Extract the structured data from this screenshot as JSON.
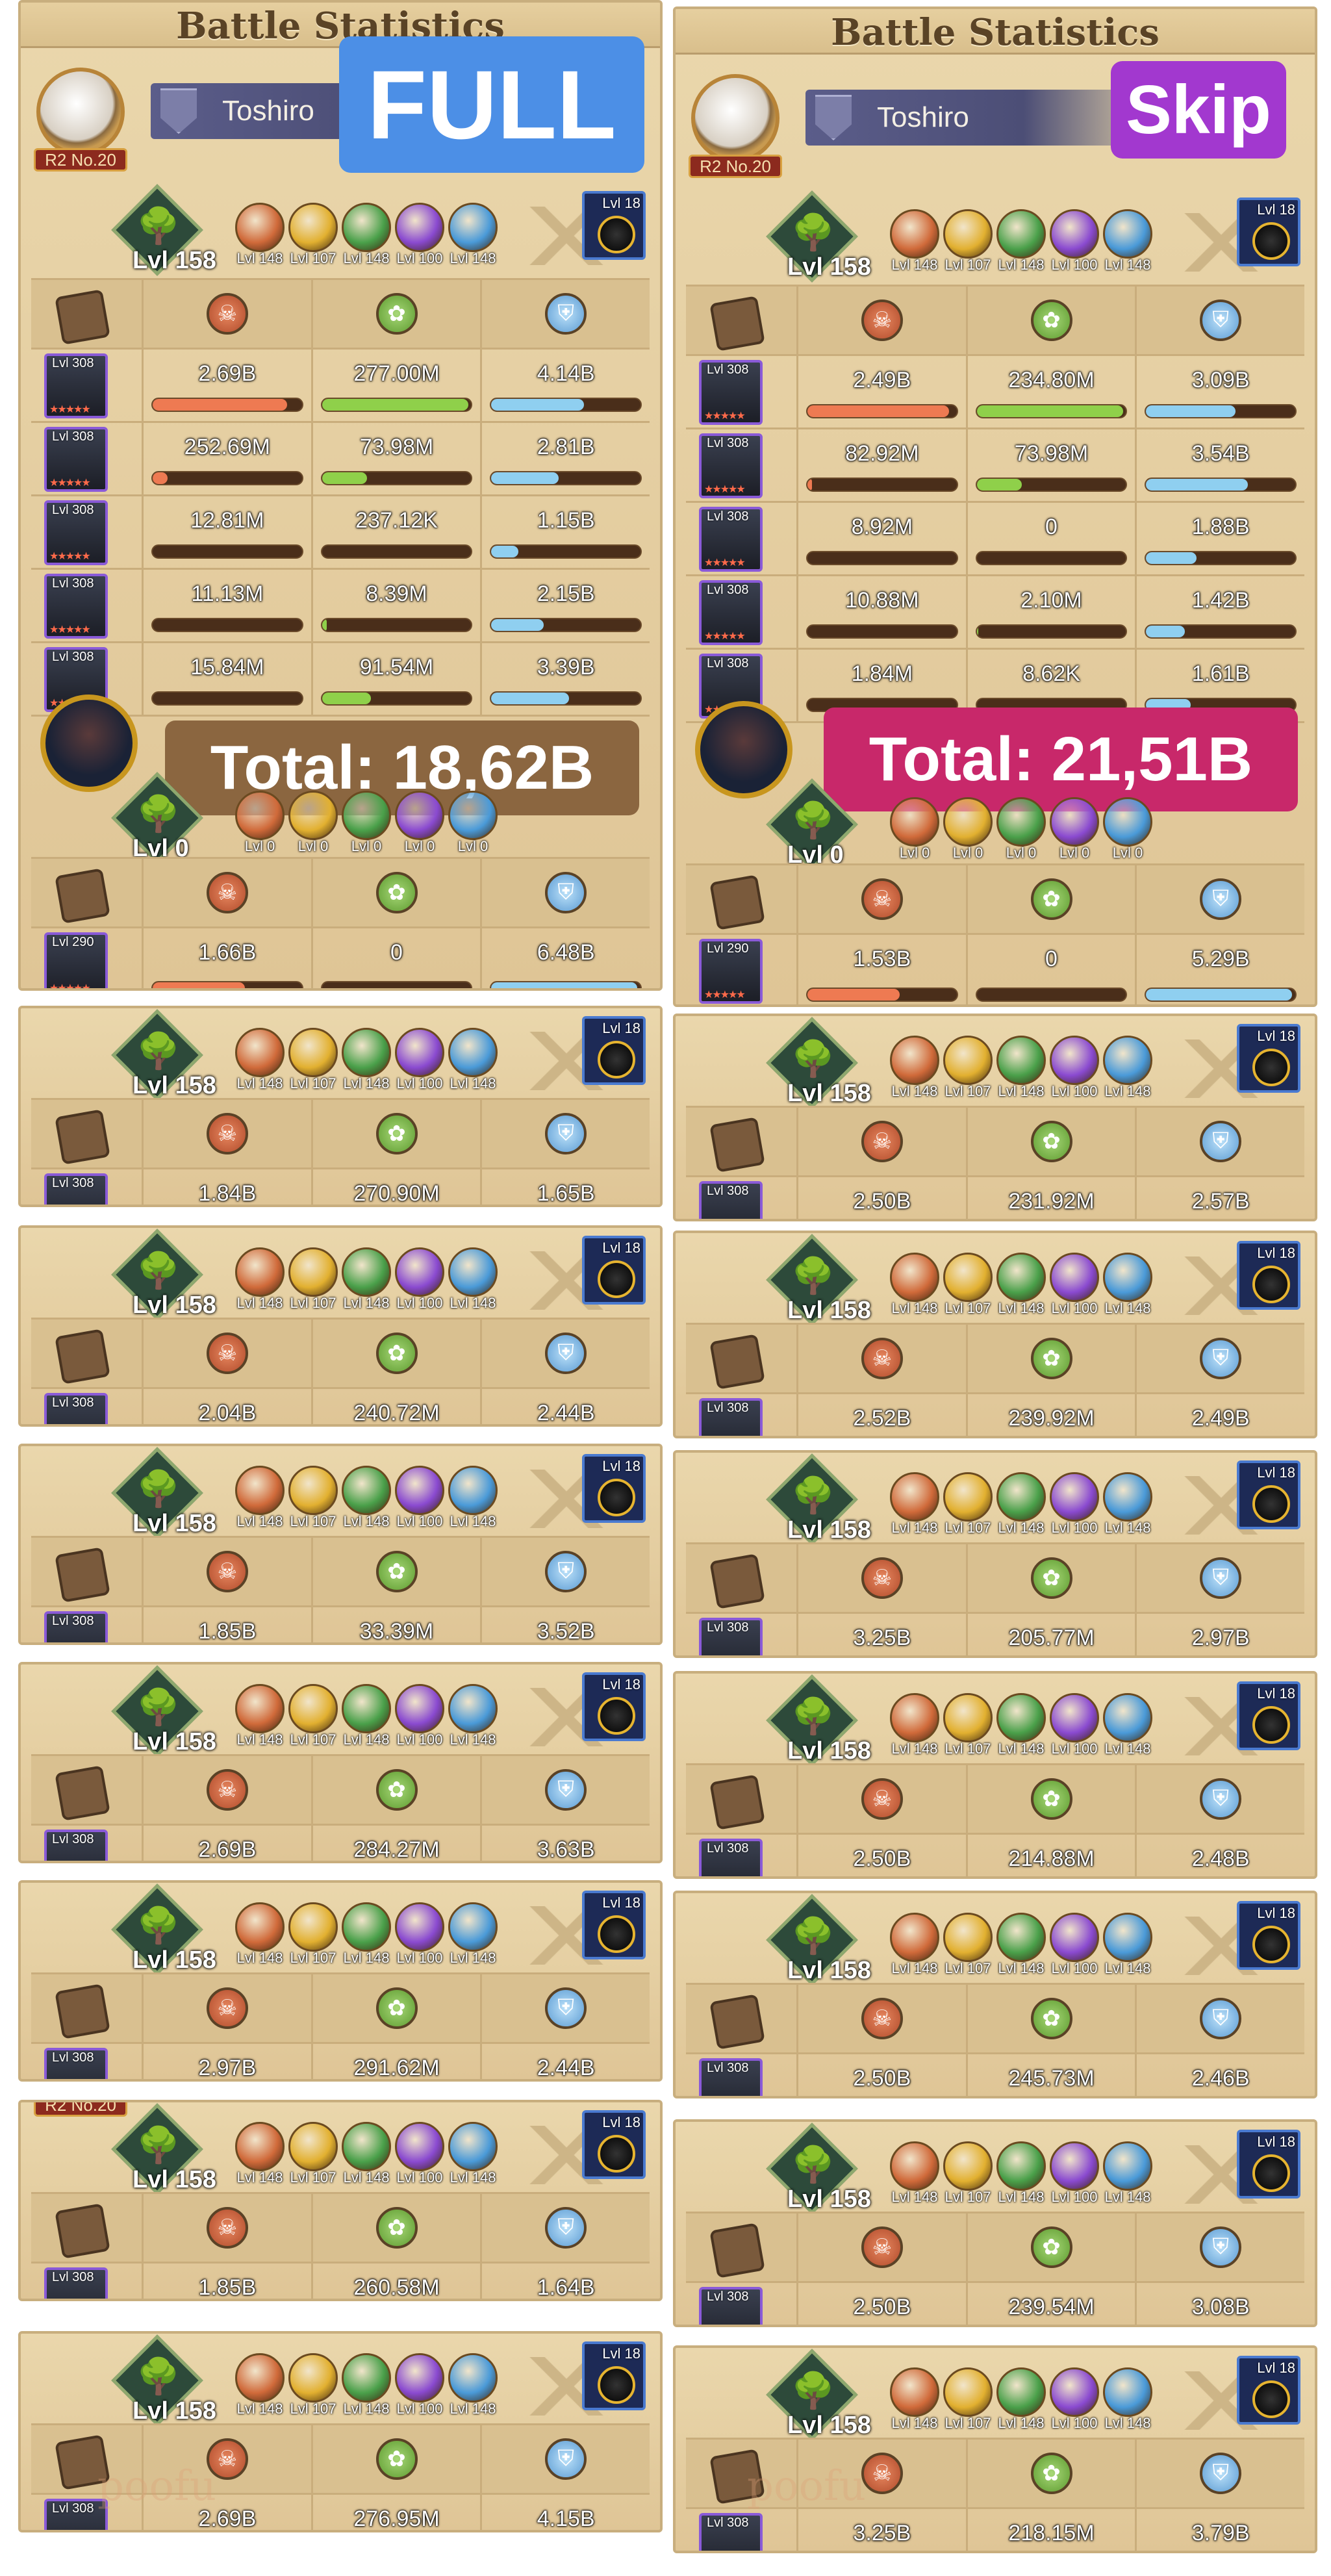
{
  "header_title": "Battle Statistics",
  "columns": [
    {
      "id": "left",
      "tag": {
        "text": "FULL",
        "color": "#4c8fe6"
      },
      "player": {
        "name": "Toshiro",
        "rank": "R2 No.20"
      },
      "team": {
        "level": "Lvl 158",
        "orb_levels": [
          "Lvl 148",
          "Lvl 107",
          "Lvl 148",
          "Lvl 100",
          "Lvl 148"
        ],
        "beast_level": "Lvl 18"
      },
      "heroes": [
        {
          "level": "Lvl 308",
          "stars": "★★★★★",
          "dmg": "2.69B",
          "heal": "277.00M",
          "def": "4.14B",
          "dmg_f": 0.9,
          "heal_f": 0.98,
          "def_f": 0.62
        },
        {
          "level": "Lvl 308",
          "stars": "★★★★★",
          "dmg": "252.69M",
          "heal": "73.98M",
          "def": "2.81B",
          "dmg_f": 0.1,
          "heal_f": 0.3,
          "def_f": 0.45
        },
        {
          "level": "Lvl 308",
          "stars": "★★★★★",
          "dmg": "12.81M",
          "heal": "237.12K",
          "def": "1.15B",
          "dmg_f": 0.0,
          "heal_f": 0.0,
          "def_f": 0.18
        },
        {
          "level": "Lvl 308",
          "stars": "★★★★★",
          "dmg": "11.13M",
          "heal": "8.39M",
          "def": "2.15B",
          "dmg_f": 0.0,
          "heal_f": 0.03,
          "def_f": 0.35
        },
        {
          "level": "Lvl 308",
          "stars": "★★",
          "dmg": "15.84M",
          "heal": "91.54M",
          "def": "3.39B",
          "dmg_f": 0.0,
          "heal_f": 0.33,
          "def_f": 0.52
        }
      ],
      "total": {
        "text": "Total: 18,62B",
        "color": "#8b6640"
      },
      "enemy": {
        "level": "Lvl 0",
        "orb_levels": [
          "Lvl 0",
          "Lvl 0",
          "Lvl 0",
          "Lvl 0",
          "Lvl 0"
        ],
        "hero": {
          "level": "Lvl 290",
          "stars": "★★★★★",
          "dmg": "1.66B",
          "heal": "0",
          "def": "6.48B",
          "dmg_f": 0.62,
          "heal_f": 0.0,
          "def_f": 0.98
        }
      },
      "runs": [
        {
          "dmg": "1.84B",
          "heal": "270.90M",
          "def": "1.65B",
          "dmg_f": 0.98,
          "heal_f": 0.98,
          "def_f": 0.45
        },
        {
          "dmg": "2.04B",
          "heal": "240.72M",
          "def": "2.44B",
          "dmg_f": 0.98,
          "heal_f": 0.98,
          "def_f": 0.45
        },
        {
          "dmg": "1.85B",
          "heal": "33.39M",
          "def": "3.52B",
          "dmg_f": 0.98,
          "heal_f": 0.3,
          "def_f": 0.55
        },
        {
          "dmg": "2.69B",
          "heal": "284.27M",
          "def": "3.63B",
          "dmg_f": 0.98,
          "heal_f": 0.98,
          "def_f": 0.55
        },
        {
          "dmg": "2.97B",
          "heal": "291.62M",
          "def": "2.44B",
          "dmg_f": 0.98,
          "heal_f": 0.98,
          "def_f": 0.45
        },
        {
          "dmg": "1.85B",
          "heal": "260.58M",
          "def": "1.64B",
          "dmg_f": 0.98,
          "heal_f": 0.98,
          "def_f": 0.35
        },
        {
          "dmg": "2.69B",
          "heal": "276.95M",
          "def": "4.15B",
          "dmg_f": 0.98,
          "heal_f": 0.98,
          "def_f": 0.6
        }
      ]
    },
    {
      "id": "right",
      "tag": {
        "text": "Skip",
        "color": "#a238cf"
      },
      "player": {
        "name": "Toshiro",
        "rank": "R2 No.20"
      },
      "team": {
        "level": "Lvl 158",
        "orb_levels": [
          "Lvl 148",
          "Lvl 107",
          "Lvl 148",
          "Lvl 100",
          "Lvl 148"
        ],
        "beast_level": "Lvl 18"
      },
      "heroes": [
        {
          "level": "Lvl 308",
          "stars": "★★★★★",
          "dmg": "2.49B",
          "heal": "234.80M",
          "def": "3.09B",
          "dmg_f": 0.95,
          "heal_f": 0.98,
          "def_f": 0.6
        },
        {
          "level": "Lvl 308",
          "stars": "★★★★★",
          "dmg": "82.92M",
          "heal": "73.98M",
          "def": "3.54B",
          "dmg_f": 0.03,
          "heal_f": 0.3,
          "def_f": 0.68
        },
        {
          "level": "Lvl 308",
          "stars": "★★★★★",
          "dmg": "8.92M",
          "heal": "0",
          "def": "1.88B",
          "dmg_f": 0.0,
          "heal_f": 0.0,
          "def_f": 0.34
        },
        {
          "level": "Lvl 308",
          "stars": "★★★★★",
          "dmg": "10.88M",
          "heal": "2.10M",
          "def": "1.42B",
          "dmg_f": 0.0,
          "heal_f": 0.01,
          "def_f": 0.26
        },
        {
          "level": "Lvl 308",
          "stars": "★★",
          "dmg": "1.84M",
          "heal": "8.62K",
          "def": "1.61B",
          "dmg_f": 0.0,
          "heal_f": 0.0,
          "def_f": 0.3
        }
      ],
      "total": {
        "text": "Total: 21,51B",
        "color": "#c8286a"
      },
      "enemy": {
        "level": "Lvl 0",
        "orb_levels": [
          "Lvl 0",
          "Lvl 0",
          "Lvl 0",
          "Lvl 0",
          "Lvl 0"
        ],
        "hero": {
          "level": "Lvl 290",
          "stars": "★★★★★",
          "dmg": "1.53B",
          "heal": "0",
          "def": "5.29B",
          "dmg_f": 0.62,
          "heal_f": 0.0,
          "def_f": 0.98
        }
      },
      "runs": [
        {
          "dmg": "2.50B",
          "heal": "231.92M",
          "def": "2.57B",
          "dmg_f": 0.98,
          "heal_f": 0.98,
          "def_f": 0.5
        },
        {
          "dmg": "2.52B",
          "heal": "239.92M",
          "def": "2.49B",
          "dmg_f": 0.98,
          "heal_f": 0.98,
          "def_f": 0.45
        },
        {
          "dmg": "3.25B",
          "heal": "205.77M",
          "def": "2.97B",
          "dmg_f": 0.98,
          "heal_f": 0.98,
          "def_f": 0.5
        },
        {
          "dmg": "2.50B",
          "heal": "214.88M",
          "def": "2.48B",
          "dmg_f": 0.98,
          "heal_f": 0.98,
          "def_f": 0.45
        },
        {
          "dmg": "2.50B",
          "heal": "245.73M",
          "def": "2.46B",
          "dmg_f": 0.98,
          "heal_f": 0.98,
          "def_f": 0.45
        },
        {
          "dmg": "2.50B",
          "heal": "239.54M",
          "def": "3.08B",
          "dmg_f": 0.98,
          "heal_f": 0.98,
          "def_f": 0.5
        },
        {
          "dmg": "3.25B",
          "heal": "218.15M",
          "def": "3.79B",
          "dmg_f": 0.98,
          "heal_f": 0.98,
          "def_f": 0.55
        }
      ]
    }
  ],
  "stat_icons": {
    "dmg": "attack-skull-icon",
    "heal": "heal-leaf-icon",
    "def": "shield-icon"
  },
  "orb_colors": [
    "#d06a3a",
    "#e2b030",
    "#4aa04a",
    "#8a4ad0",
    "#4a9ad8"
  ],
  "left_run6_rank_label": "R2 No.20",
  "watermarks": [
    "poofu",
    "poofu"
  ]
}
